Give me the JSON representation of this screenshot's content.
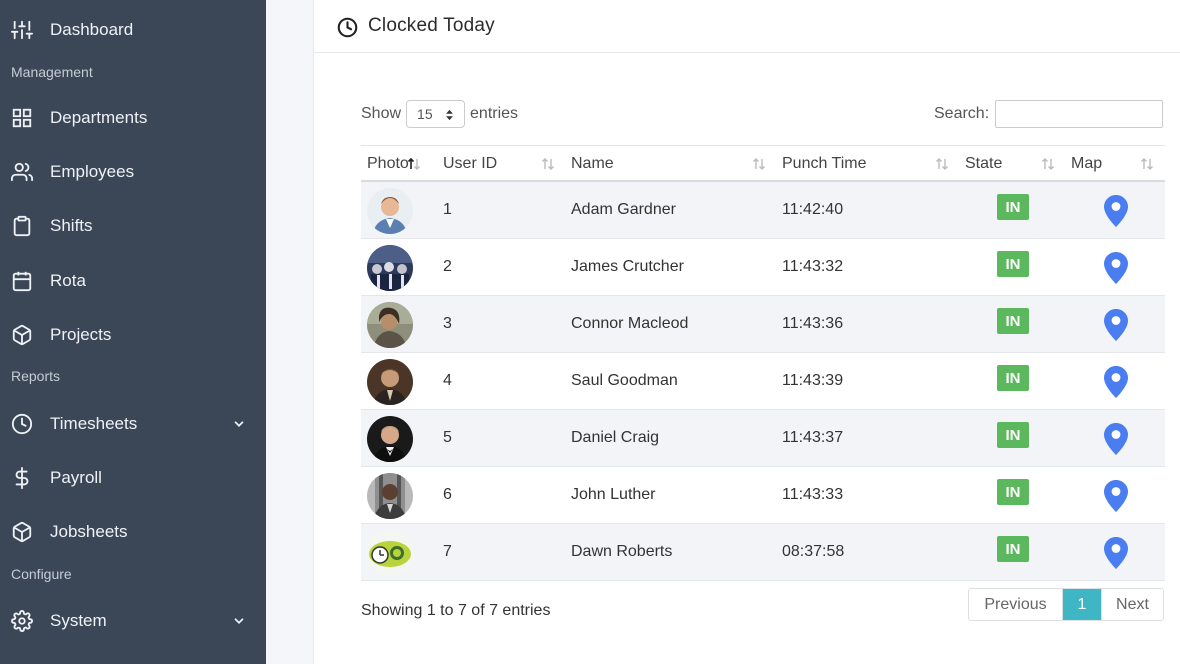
{
  "sidebar": {
    "items": [
      {
        "label": "Dashboard",
        "icon": "sliders-icon"
      },
      {
        "label": "Departments",
        "icon": "grid-icon"
      },
      {
        "label": "Employees",
        "icon": "users-icon"
      },
      {
        "label": "Shifts",
        "icon": "clipboard-icon"
      },
      {
        "label": "Rota",
        "icon": "calendar-icon"
      },
      {
        "label": "Projects",
        "icon": "box-icon"
      },
      {
        "label": "Timesheets",
        "icon": "clock-icon"
      },
      {
        "label": "Payroll",
        "icon": "dollar-icon"
      },
      {
        "label": "Jobsheets",
        "icon": "box-icon"
      },
      {
        "label": "System",
        "icon": "gear-icon"
      }
    ],
    "sections": [
      "Management",
      "Reports",
      "Configure"
    ]
  },
  "panel": {
    "title": "Clocked Today",
    "icon": "clock-icon"
  },
  "controls": {
    "show_label": "Show",
    "entries_value": "15",
    "entries_label": "entries",
    "search_label": "Search:",
    "search_value": ""
  },
  "table": {
    "columns": [
      "Photo",
      "User ID",
      "Name",
      "Punch Time",
      "State",
      "Map"
    ],
    "rows": [
      {
        "id": "1",
        "name": "Adam Gardner",
        "time": "11:42:40",
        "state": "IN"
      },
      {
        "id": "2",
        "name": "James Crutcher",
        "time": "11:43:32",
        "state": "IN"
      },
      {
        "id": "3",
        "name": "Connor Macleod",
        "time": "11:43:36",
        "state": "IN"
      },
      {
        "id": "4",
        "name": "Saul Goodman",
        "time": "11:43:39",
        "state": "IN"
      },
      {
        "id": "5",
        "name": "Daniel Craig",
        "time": "11:43:37",
        "state": "IN"
      },
      {
        "id": "6",
        "name": "John Luther",
        "time": "11:43:33",
        "state": "IN"
      },
      {
        "id": "7",
        "name": "Dawn Roberts",
        "time": "08:37:58",
        "state": "IN"
      }
    ]
  },
  "footer": {
    "info": "Showing 1 to 7 of 7 entries",
    "prev": "Previous",
    "page": "1",
    "next": "Next"
  },
  "colors": {
    "sidebar_bg": "#3b4757",
    "state_in": "#5cb85c",
    "pin": "#4a7ef0",
    "active_page": "#3fb6c3"
  }
}
